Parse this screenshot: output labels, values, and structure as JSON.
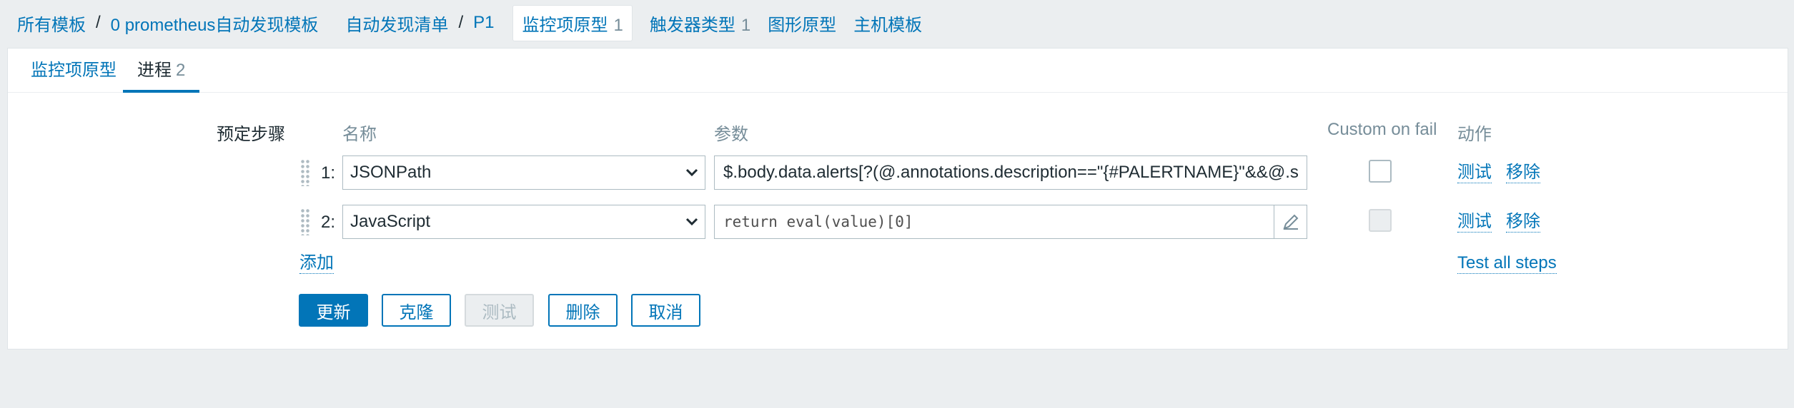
{
  "breadcrumb": {
    "all_templates": "所有模板",
    "template": "0 prometheus自动发现模板",
    "discovery_list": "自动发现清单",
    "rule": "P1",
    "item_prototypes": "监控项原型",
    "item_prototypes_count": "1",
    "trigger_types": "触发器类型",
    "trigger_types_count": "1",
    "graph_prototypes": "图形原型",
    "host_templates": "主机模板",
    "separator": "/"
  },
  "tabs": [
    {
      "label": "监控项原型",
      "count": ""
    },
    {
      "label": "进程",
      "count": "2"
    }
  ],
  "form": {
    "preprocessing_label": "预定步骤",
    "headers": {
      "name": "名称",
      "params": "参数",
      "custom_on_fail": "Custom on fail",
      "actions": "动作"
    },
    "steps": [
      {
        "num": "1:",
        "type": "JSONPath",
        "param": "$.body.data.alerts[?(@.annotations.description==\"{#PALERTNAME}\"&&@.s",
        "custom_on_fail": false,
        "custom_on_fail_enabled": true,
        "test_label": "测试",
        "remove_label": "移除"
      },
      {
        "num": "2:",
        "type": "JavaScript",
        "param": "return eval(value)[0]",
        "custom_on_fail": false,
        "custom_on_fail_enabled": false,
        "test_label": "测试",
        "remove_label": "移除"
      }
    ],
    "add_label": "添加",
    "test_all_label": "Test all steps"
  },
  "buttons": {
    "update": "更新",
    "clone": "克隆",
    "test": "测试",
    "delete": "删除",
    "cancel": "取消"
  },
  "colors": {
    "accent": "#0275b8",
    "background": "#ebeef0",
    "border": "#acbbc2"
  },
  "icons": {
    "select_arrow": "chevron-down-icon",
    "drag": "drag-handle-icon",
    "edit": "pencil-icon"
  }
}
